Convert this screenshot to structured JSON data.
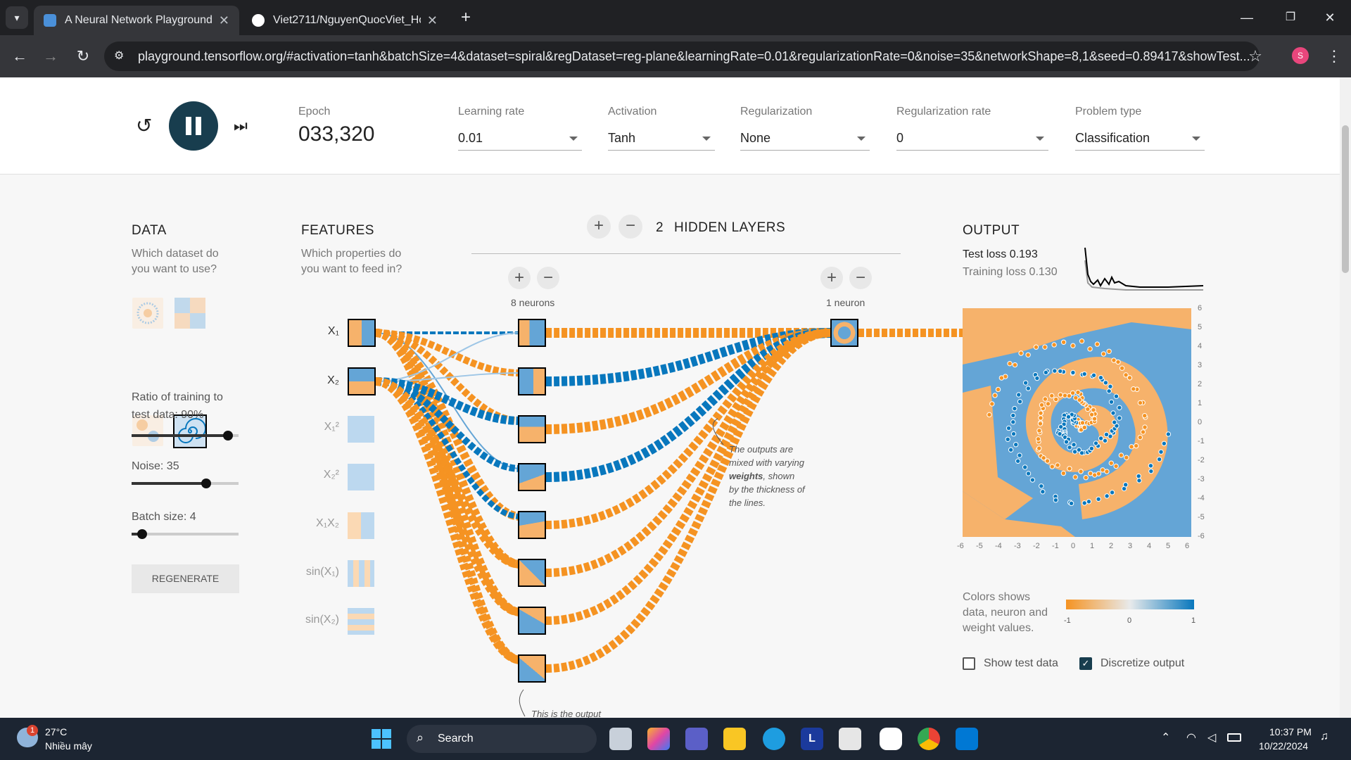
{
  "browser": {
    "tabs": [
      {
        "title": "A Neural Network Playground",
        "active": true
      },
      {
        "title": "Viet2711/NguyenQuocViet_Hoc",
        "active": false
      }
    ],
    "url": "playground.tensorflow.org/#activation=tanh&batchSize=4&dataset=spiral&regDataset=reg-plane&learningRate=0.01&regularizationRate=0&noise=35&networkShape=8,1&seed=0.89417&showTest...",
    "profile_initial": "S",
    "new_tab": "+"
  },
  "controls": {
    "epoch_label": "Epoch",
    "epoch_value": "033,320",
    "learning_rate": {
      "label": "Learning rate",
      "value": "0.01"
    },
    "activation": {
      "label": "Activation",
      "value": "Tanh"
    },
    "regularization": {
      "label": "Regularization",
      "value": "None"
    },
    "regularization_rate": {
      "label": "Regularization rate",
      "value": "0"
    },
    "problem_type": {
      "label": "Problem type",
      "value": "Classification"
    }
  },
  "data_panel": {
    "title": "DATA",
    "subtitle_1": "Which dataset do",
    "subtitle_2": "you want to use?",
    "ratio_label_1": "Ratio of training to",
    "ratio_label_2": "test data:  90%",
    "ratio_value": 0.9,
    "noise_label": "Noise:  35",
    "noise_value": 0.7,
    "batch_label": "Batch size:  4",
    "batch_value": 0.1,
    "regenerate": "REGENERATE"
  },
  "features_panel": {
    "title": "FEATURES",
    "subtitle_1": "Which properties do",
    "subtitle_2": "you want to feed in?",
    "features": [
      "X₁",
      "X₂",
      "X₁²",
      "X₂²",
      "X₁X₂",
      "sin(X₁)",
      "sin(X₂)"
    ]
  },
  "network": {
    "hidden_count": "2",
    "hidden_label": "HIDDEN LAYERS",
    "layer1_label": "8 neurons",
    "layer2_label": "1 neuron",
    "annotation_1": "The outputs are",
    "annotation_2": "mixed with varying",
    "annotation_3": "weights",
    "annotation_3b": ", shown",
    "annotation_4": "by the thickness of",
    "annotation_5": "the lines.",
    "bottom_note": "This is the output"
  },
  "output_panel": {
    "title": "OUTPUT",
    "test_loss": "Test loss 0.193",
    "training_loss": "Training loss 0.130",
    "y_ticks": [
      "6",
      "5",
      "4",
      "3",
      "2",
      "1",
      "0",
      "-1",
      "-2",
      "-3",
      "-4",
      "-5",
      "-6"
    ],
    "x_ticks": [
      "-6",
      "-5",
      "-4",
      "-3",
      "-2",
      "-1",
      "0",
      "1",
      "2",
      "3",
      "4",
      "5",
      "6"
    ],
    "legend_1": "Colors shows",
    "legend_2": "data, neuron and",
    "legend_3": "weight values.",
    "scale_min": "-1",
    "scale_mid": "0",
    "scale_max": "1",
    "show_test_data": "Show test data",
    "discretize_output": "Discretize output"
  },
  "colors": {
    "orange": "#f59322",
    "blue": "#0877bd",
    "light_orange": "#f6b26b",
    "light_blue": "#64a5d6"
  },
  "taskbar": {
    "temperature": "27°C",
    "weather": "Nhiều mây",
    "search": "Search",
    "time": "10:37 PM",
    "date": "10/22/2024",
    "badge": "1"
  }
}
